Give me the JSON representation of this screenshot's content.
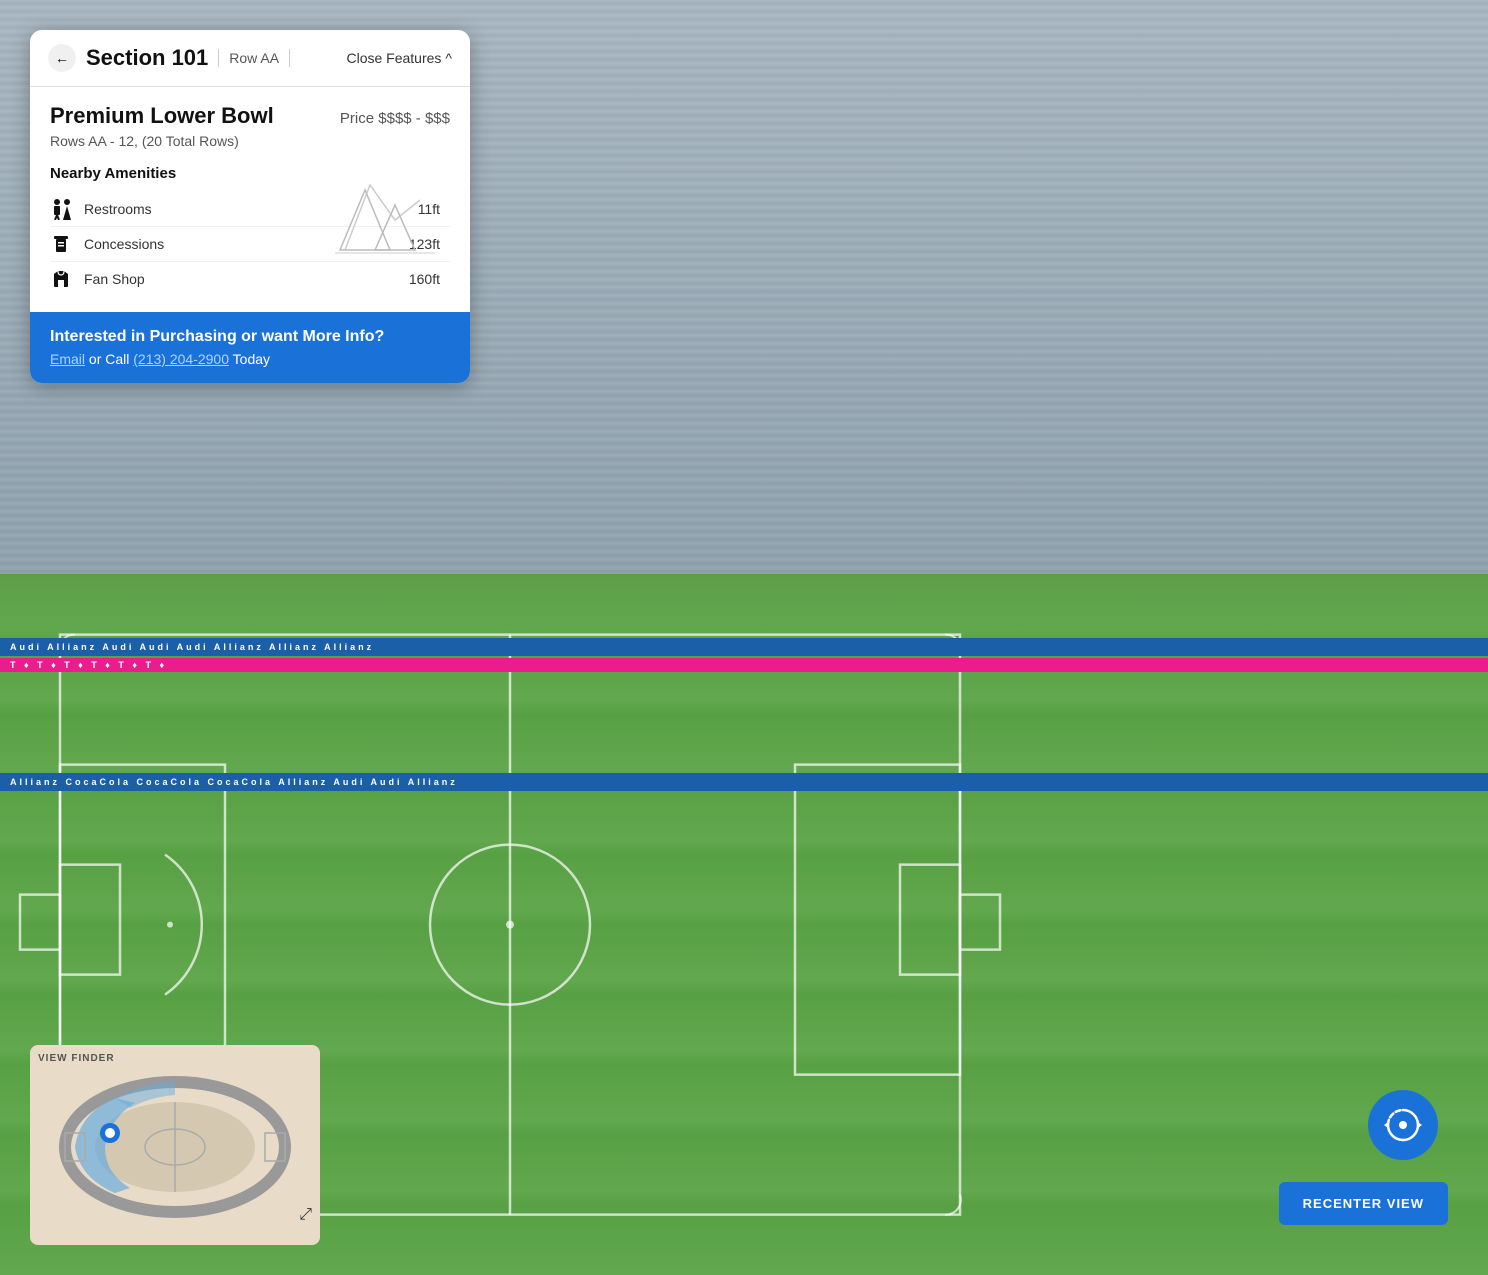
{
  "header": {
    "back_label": "←",
    "section_title": "Section 101",
    "row_label": "Row AA",
    "close_features_label": "Close Features",
    "chevron_up": "^"
  },
  "section": {
    "type": "Premium Lower Bowl",
    "price_range": "Price $$$$ - $$$",
    "rows_info": "Rows AA - 12, (20 Total Rows)"
  },
  "amenities": {
    "title": "Nearby Amenities",
    "items": [
      {
        "icon": "restroom",
        "name": "Restrooms",
        "distance": "11ft"
      },
      {
        "icon": "concessions",
        "name": "Concessions",
        "distance": "123ft"
      },
      {
        "icon": "fanshop",
        "name": "Fan Shop",
        "distance": "160ft"
      }
    ]
  },
  "cta": {
    "title": "Interested in Purchasing or want More Info?",
    "prefix": " or Call ",
    "email_label": "Email",
    "phone": "(213) 204-2900",
    "suffix": " Today"
  },
  "viewfinder": {
    "label": "VIEW FINDER",
    "expand_icon": "⤢"
  },
  "recenter": {
    "label": "RECENTER VIEW"
  },
  "ads": {
    "top_text": "Audi   Allianz   Audi   Audi   Audi   Allianz   Allianz   Allianz",
    "bottom_text": "Allianz   CocaCola   CocaCola   CocaCola   Allianz   Audi   Audi   Allianz",
    "pink_text": "T   ♦   T   ♦   T   ♦   T   ♦   T   ♦   T   ♦"
  }
}
